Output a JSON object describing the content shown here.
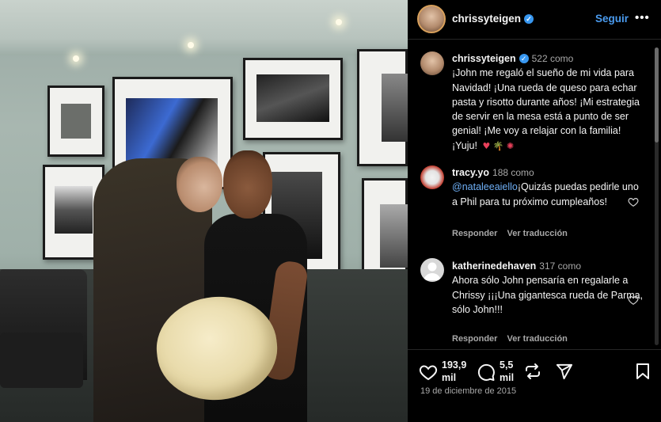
{
  "header": {
    "username": "chrissyteigen",
    "follow_label": "Seguir",
    "more_label": "•••"
  },
  "caption": {
    "username": "chrissyteigen",
    "meta": "522 como",
    "text": "¡John me regaló el sueño de mi vida para Navidad! ¡Una rueda de queso para echar pasta y risotto durante años! ¡Mi estrategia de servir en la mesa está a punto de ser genial! ¡Me voy a relajar con la familia! ¡Yuju!",
    "emojis": "♥ 🌴 ✺"
  },
  "comments": [
    {
      "username": "tracy.yo",
      "meta": "188 como",
      "mention": "@nataleeaiello",
      "text": "¡Quizás puedas pedirle uno a Phil para tu próximo cumpleaños!",
      "reply_label": "Responder",
      "translate_label": "Ver traducción"
    },
    {
      "username": "katherinedehaven",
      "meta": "317 como",
      "mention": "",
      "text": "Ahora sólo John pensaría en regalarle a Chrissy ¡¡¡Una gigantesca rueda de Parma, sólo John!!!",
      "reply_label": "Responder",
      "translate_label": "Ver traducción"
    }
  ],
  "footer": {
    "likes": "193,9\nmil",
    "likes_line1": "193,9",
    "likes_line2": "mil",
    "comments_line1": "5,5",
    "comments_line2": "mil",
    "date": "19 de diciembre de 2015"
  },
  "colors": {
    "link": "#4a9bef",
    "verified": "#3897f0",
    "muted": "#a8a8a8"
  }
}
